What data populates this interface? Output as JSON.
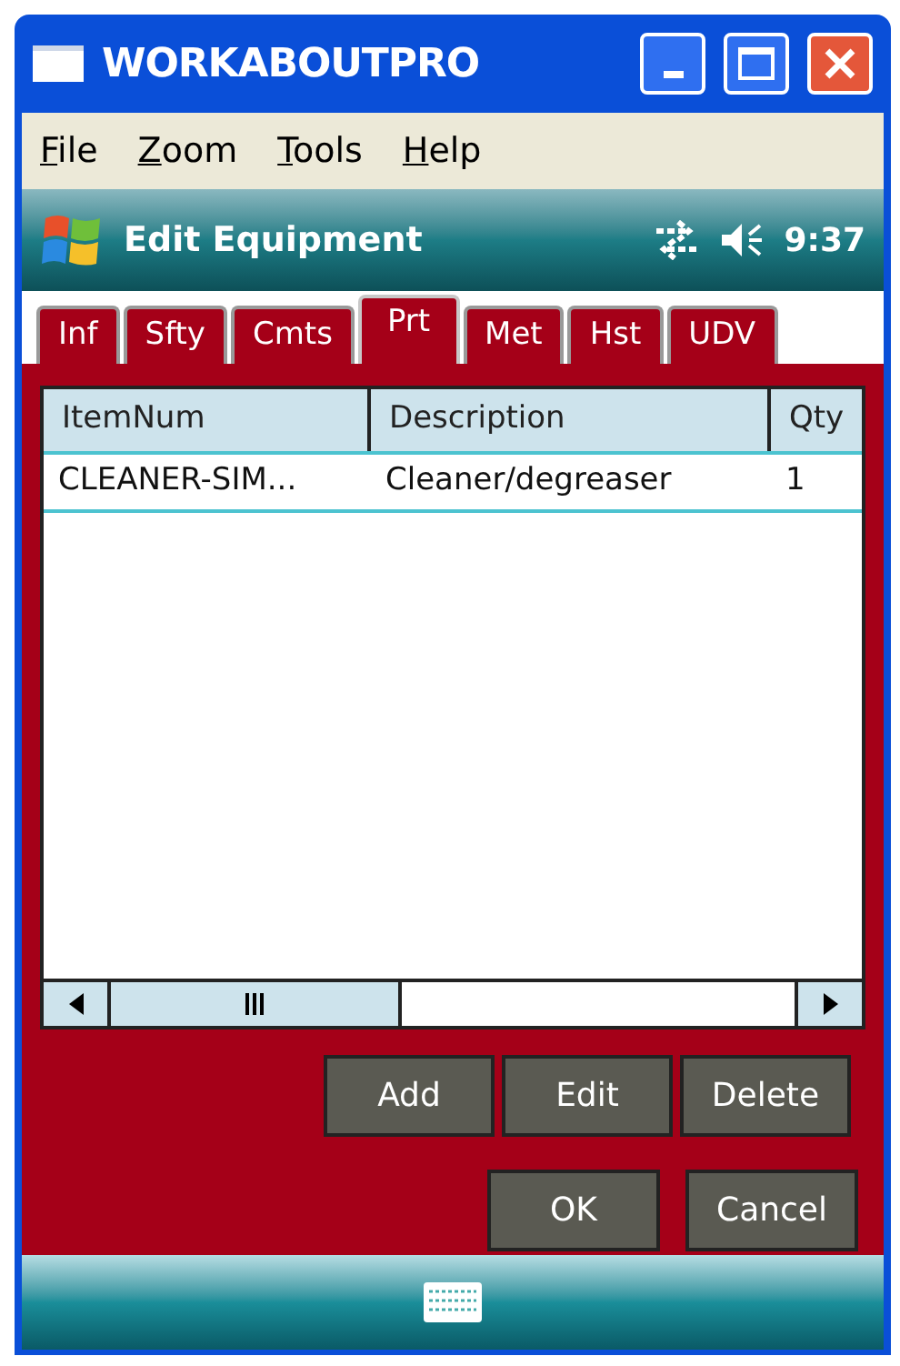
{
  "window": {
    "title": "WORKABOUTPRO"
  },
  "menu": [
    {
      "label": "File"
    },
    {
      "label": "Zoom"
    },
    {
      "label": "Tools"
    },
    {
      "label": "Help"
    }
  ],
  "status_bar": {
    "title": "Edit Equipment",
    "time": "9:37"
  },
  "tabs": [
    {
      "label": "Inf",
      "selected": false
    },
    {
      "label": "Sfty",
      "selected": false
    },
    {
      "label": "Cmts",
      "selected": false
    },
    {
      "label": "Prt",
      "selected": true
    },
    {
      "label": "Met",
      "selected": false
    },
    {
      "label": "Hst",
      "selected": false
    },
    {
      "label": "UDV",
      "selected": false
    }
  ],
  "table": {
    "columns": [
      "ItemNum",
      "Description",
      "Qty"
    ],
    "rows": [
      [
        "CLEANER-SIM...",
        "Cleaner/degreaser",
        "1"
      ]
    ]
  },
  "buttons": [
    "Add",
    "Edit",
    "Delete"
  ],
  "dialog_buttons": [
    "OK",
    "Cancel"
  ]
}
